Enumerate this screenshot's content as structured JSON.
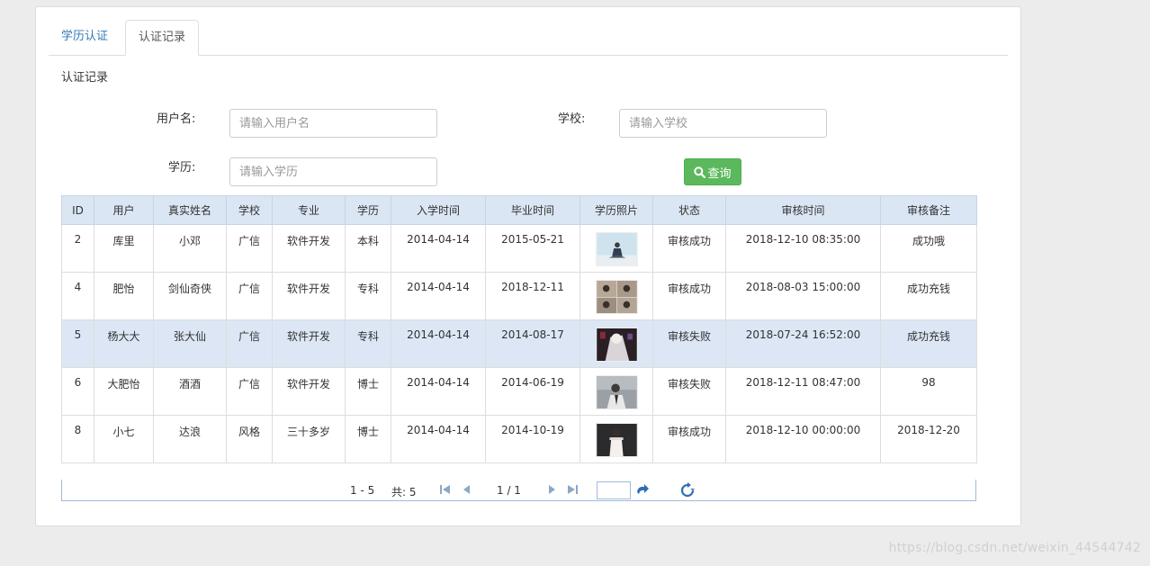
{
  "tabs": [
    {
      "label": "学历认证"
    },
    {
      "label": "认证记录"
    }
  ],
  "section_title": "认证记录",
  "form": {
    "username_label": "用户名:",
    "username_placeholder": "请输入用户名",
    "school_label": "学校:",
    "school_placeholder": "请输入学校",
    "degree_label": "学历:",
    "degree_placeholder": "请输入学历",
    "query_label": "查询"
  },
  "table": {
    "headers": [
      "ID",
      "用户",
      "真实姓名",
      "学校",
      "专业",
      "学历",
      "入学时间",
      "毕业时间",
      "学历照片",
      "状态",
      "审核时间",
      "审核备注"
    ],
    "rows": [
      {
        "id": "2",
        "user": "库里",
        "real_name": "小邓",
        "school": "广信",
        "major": "软件开发",
        "degree": "本科",
        "enroll": "2014-04-14",
        "graduate": "2015-05-21",
        "status": "审核成功",
        "review_time": "2018-12-10 08:35:00",
        "remark": "成功哦"
      },
      {
        "id": "4",
        "user": "肥怡",
        "real_name": "剑仙奇侠",
        "school": "广信",
        "major": "软件开发",
        "degree": "专科",
        "enroll": "2014-04-14",
        "graduate": "2018-12-11",
        "status": "审核成功",
        "review_time": "2018-08-03 15:00:00",
        "remark": "成功充钱"
      },
      {
        "id": "5",
        "user": "杨大大",
        "real_name": "张大仙",
        "school": "广信",
        "major": "软件开发",
        "degree": "专科",
        "enroll": "2014-04-14",
        "graduate": "2014-08-17",
        "status": "审核失败",
        "review_time": "2018-07-24 16:52:00",
        "remark": "成功充钱"
      },
      {
        "id": "6",
        "user": "大肥怡",
        "real_name": "酒酒",
        "school": "广信",
        "major": "软件开发",
        "degree": "博士",
        "enroll": "2014-04-14",
        "graduate": "2014-06-19",
        "status": "审核失败",
        "review_time": "2018-12-11 08:47:00",
        "remark": "98"
      },
      {
        "id": "8",
        "user": "小七",
        "real_name": "达浪",
        "school": "风格",
        "major": "三十多岁",
        "degree": "博士",
        "enroll": "2014-04-14",
        "graduate": "2014-10-19",
        "status": "审核成功",
        "review_time": "2018-12-10 00:00:00",
        "remark": "2018-12-20"
      }
    ]
  },
  "pager": {
    "range": "1 - 5",
    "total": "共: 5",
    "page": "1 / 1"
  },
  "watermark": "https://blog.csdn.net/weixin_44544742"
}
